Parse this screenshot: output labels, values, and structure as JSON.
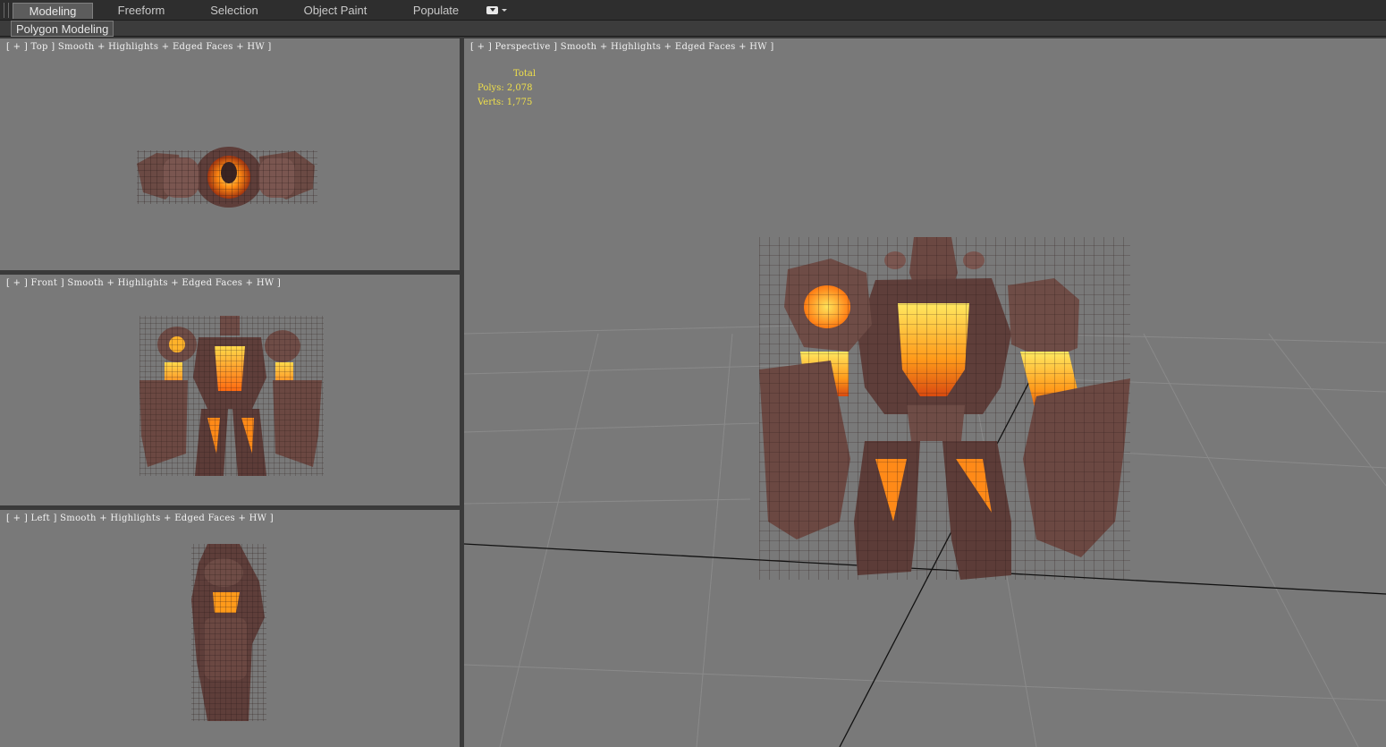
{
  "ribbon": {
    "tabs": [
      {
        "label": "Modeling",
        "active": true
      },
      {
        "label": "Freeform"
      },
      {
        "label": "Selection"
      },
      {
        "label": "Object Paint"
      },
      {
        "label": "Populate"
      }
    ],
    "options_icon": "dropdown-icon"
  },
  "panel_label": "Polygon Modeling",
  "viewports": {
    "top": {
      "label": "[ + ] Top ] Smooth + Highlights + Edged Faces + HW ]"
    },
    "front": {
      "label": "[ + ] Front ] Smooth + Highlights + Edged Faces + HW ]"
    },
    "left": {
      "label": "[ + ] Left ] Smooth + Highlights + Edged Faces + HW ]"
    },
    "perspective": {
      "label": "[ + ] Perspective ] Smooth + Highlights + Edged Faces + HW ]"
    }
  },
  "stats": {
    "header": "Total",
    "polys": "Polys: 2,078",
    "verts": "Verts: 1,775"
  },
  "colors": {
    "viewport_bg": "#797979",
    "stats_text": "#f0e04a",
    "rock": "#6e4b44",
    "lava": "#ff9a1a"
  }
}
